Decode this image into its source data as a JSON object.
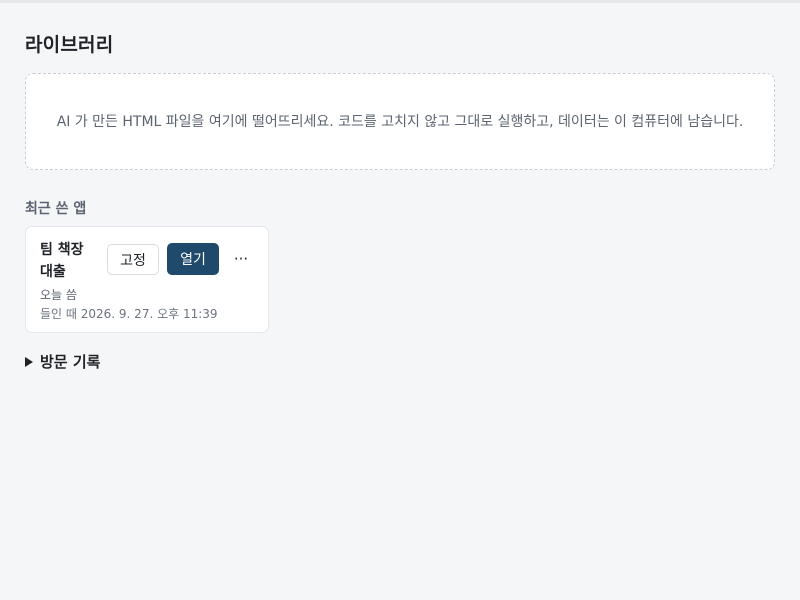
{
  "page": {
    "title": "라이브러리"
  },
  "dropzone": {
    "text": "AI 가 만든 HTML 파일을 여기에 떨어뜨리세요. 코드를 고치지 않고 그대로 실행하고, 데이터는 이 컴퓨터에 남습니다."
  },
  "recent": {
    "label": "최근 쓴 앱",
    "apps": [
      {
        "name": "팀 책장 대출",
        "pin_label": "고정",
        "open_label": "열기",
        "more_label": "···",
        "used_text": "오늘 씀",
        "installed_text": "들인 때 2026. 9. 27. 오후 11:39"
      }
    ]
  },
  "history": {
    "label": "방문 기록",
    "icon": "triangle-right-icon",
    "expanded": false
  },
  "colors": {
    "background": "#f5f6f8",
    "card": "#ffffff",
    "primary_button": "#1f4a6b",
    "muted_text": "#5b6470"
  }
}
